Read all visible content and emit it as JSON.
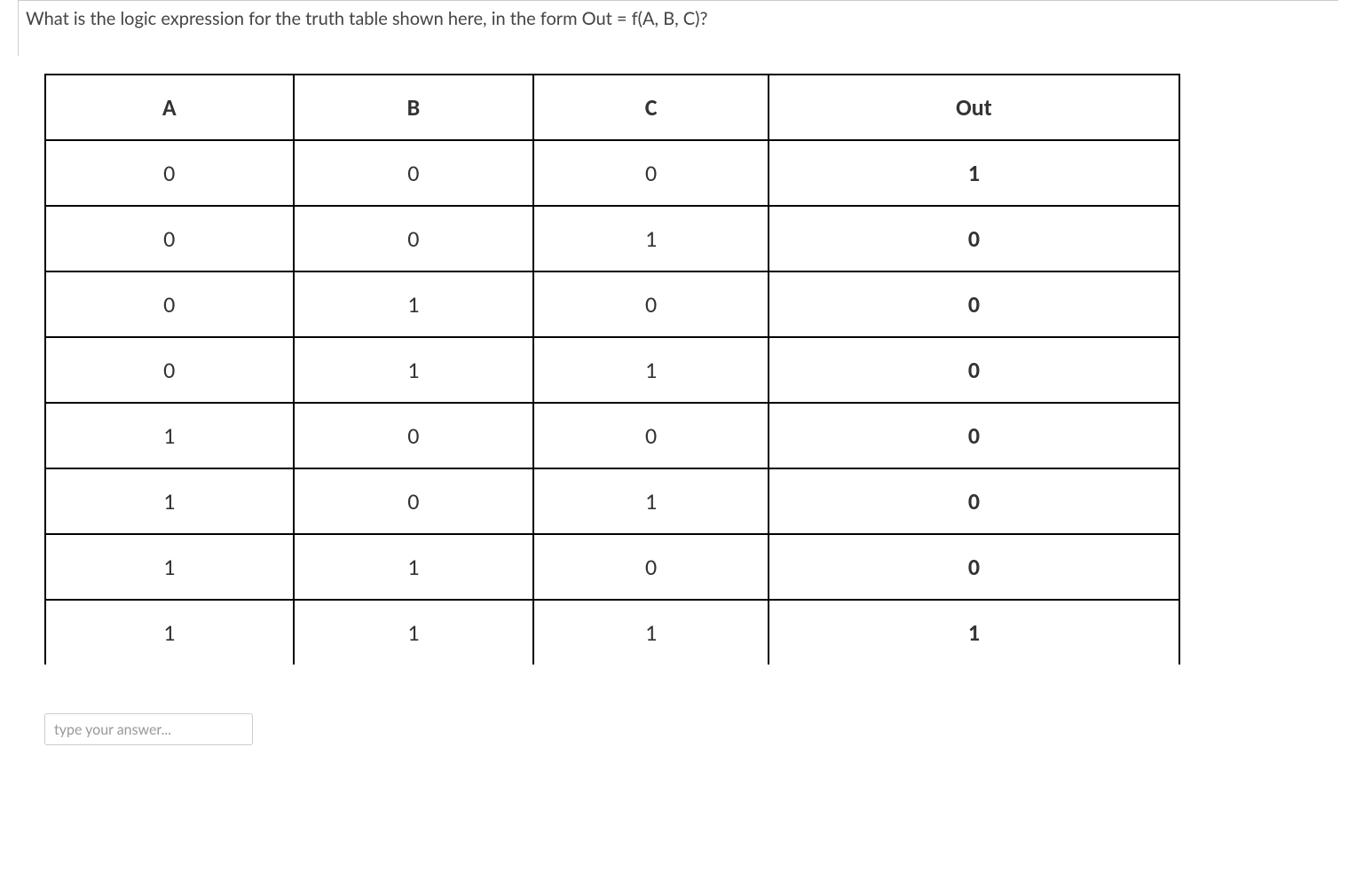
{
  "question": "What is the logic expression for the truth table shown here, in the form Out = f(A, B, C)?",
  "table": {
    "headers": [
      "A",
      "B",
      "C",
      "Out"
    ],
    "rows": [
      [
        "0",
        "0",
        "0",
        "1"
      ],
      [
        "0",
        "0",
        "1",
        "0"
      ],
      [
        "0",
        "1",
        "0",
        "0"
      ],
      [
        "0",
        "1",
        "1",
        "0"
      ],
      [
        "1",
        "0",
        "0",
        "0"
      ],
      [
        "1",
        "0",
        "1",
        "0"
      ],
      [
        "1",
        "1",
        "0",
        "0"
      ],
      [
        "1",
        "1",
        "1",
        "1"
      ]
    ]
  },
  "answer": {
    "placeholder": "type your answer...",
    "value": ""
  }
}
